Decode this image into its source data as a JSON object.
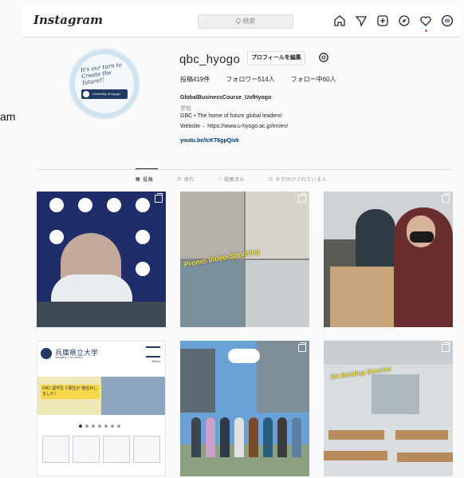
{
  "side_label": "am",
  "header": {
    "logo": "Instagram",
    "search_placeholder": "Q 検索",
    "icons": [
      "home-icon",
      "direct-icon",
      "new-post-icon",
      "explore-icon",
      "heart-icon",
      "profile-icon"
    ]
  },
  "profile": {
    "username": "qbc_hyogo",
    "edit_button": "プロフィールを編集",
    "stats": {
      "posts": "投稿419件",
      "followers": "フォロワー514人",
      "following": "フォロー中60人"
    },
    "bio": {
      "name": "GlobalBusinessCourse_UofHyogo",
      "category": "学校",
      "line1": "GBC • The home of future global leaders!",
      "line2": "Website→ https://www.u-hyogo.ac.jp/en/en/",
      "link": "youtu.be/IcKT6gpQivk"
    },
    "avatar": {
      "script": "It's our turn to Create the future!!",
      "logo_text": "University of Hyogo"
    }
  },
  "tabs": [
    {
      "label": "投稿",
      "icon": "grid-icon",
      "active": true
    },
    {
      "label": "保存",
      "icon": "bookmark-icon",
      "active": false
    },
    {
      "label": "視聴済み",
      "icon": "reels-icon",
      "active": false
    },
    {
      "label": "タグ付けされている人",
      "icon": "tag-icon",
      "active": false
    }
  ],
  "posts": {
    "t2_overlay": "Promo Video Shooting",
    "t4": {
      "university_name": "兵庫県立大学",
      "university_sub": "UNIVERSITY OF HYOGO",
      "menu_label": "Menu",
      "banner_text": "GBC 留学生 3 期生が 宿泊日しました！"
    },
    "t6_overlay": "RA Briefing Session"
  },
  "colors": {
    "link": "#00376b",
    "accent_yellow": "#f6e63b",
    "notification": "#ed4956"
  }
}
